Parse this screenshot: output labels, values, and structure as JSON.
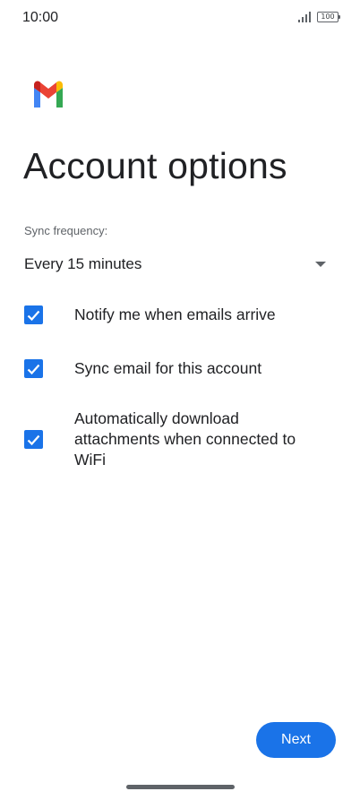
{
  "status_bar": {
    "time": "10:00",
    "battery": "100",
    "icons": [
      "signal-icon",
      "battery-icon"
    ]
  },
  "app": {
    "logo": "gmail-logo"
  },
  "page": {
    "title": "Account options"
  },
  "sync": {
    "label": "Sync frequency:",
    "selected": "Every 15 minutes",
    "icon": "dropdown-arrow-icon"
  },
  "options": [
    {
      "label": "Notify me when emails arrive",
      "checked": true
    },
    {
      "label": "Sync email for this account",
      "checked": true
    },
    {
      "label": "Automatically download attachments when connected to WiFi",
      "checked": true
    }
  ],
  "actions": {
    "next_label": "Next"
  },
  "colors": {
    "accent": "#1a73e8",
    "text": "#202124",
    "secondary_text": "#5f6368",
    "background": "#ffffff"
  }
}
